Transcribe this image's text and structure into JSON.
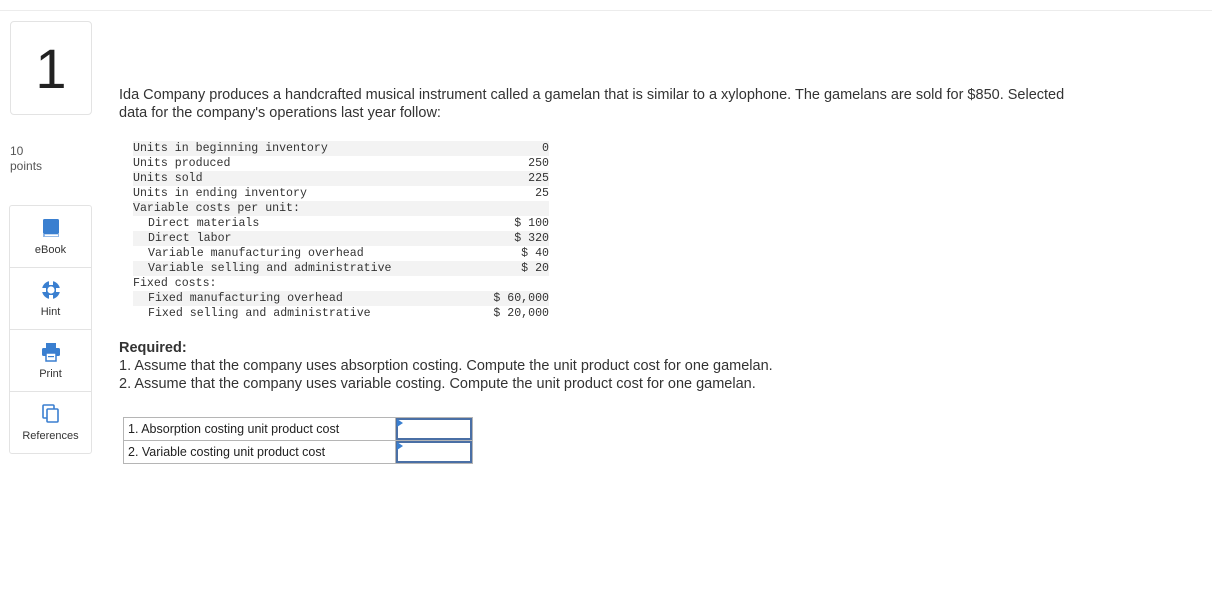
{
  "question": {
    "number": "1",
    "points_value": "10",
    "points_label": "points"
  },
  "tools": [
    {
      "label": "eBook",
      "icon": "book-icon"
    },
    {
      "label": "Hint",
      "icon": "life-ring-icon"
    },
    {
      "label": "Print",
      "icon": "printer-icon"
    },
    {
      "label": "References",
      "icon": "copy-icon"
    }
  ],
  "intro_text": "Ida Company produces a handcrafted musical instrument called a gamelan that is similar to a xylophone. The gamelans are sold for $850. Selected data for the company's operations last year follow:",
  "data_rows": [
    {
      "label": "Units in beginning inventory",
      "value": "0",
      "indent": false
    },
    {
      "label": "Units produced",
      "value": "250",
      "indent": false
    },
    {
      "label": "Units sold",
      "value": "225",
      "indent": false
    },
    {
      "label": "Units in ending inventory",
      "value": "25",
      "indent": false
    },
    {
      "label": "Variable costs per unit:",
      "value": "",
      "indent": false
    },
    {
      "label": "Direct materials",
      "value": "$ 100",
      "indent": true
    },
    {
      "label": "Direct labor",
      "value": "$ 320",
      "indent": true
    },
    {
      "label": "Variable manufacturing overhead",
      "value": "$ 40",
      "indent": true
    },
    {
      "label": "Variable selling and administrative",
      "value": "$ 20",
      "indent": true
    },
    {
      "label": "Fixed costs:",
      "value": "",
      "indent": false
    },
    {
      "label": "Fixed manufacturing overhead",
      "value": "$ 60,000",
      "indent": true
    },
    {
      "label": "Fixed selling and administrative",
      "value": "$ 20,000",
      "indent": true
    }
  ],
  "required": {
    "title": "Required:",
    "items": [
      "1. Assume that the company uses absorption costing. Compute the unit product cost for one gamelan.",
      "2. Assume that the company uses variable costing. Compute the unit product cost for one gamelan."
    ]
  },
  "answers": [
    {
      "label": "1. Absorption costing unit product cost",
      "value": "",
      "placeholder": ""
    },
    {
      "label": "2. Variable costing unit product cost",
      "value": "",
      "placeholder": ""
    }
  ],
  "colors": {
    "input_border": "#4a6fa5",
    "icon_blue": "#3a7fd0"
  }
}
